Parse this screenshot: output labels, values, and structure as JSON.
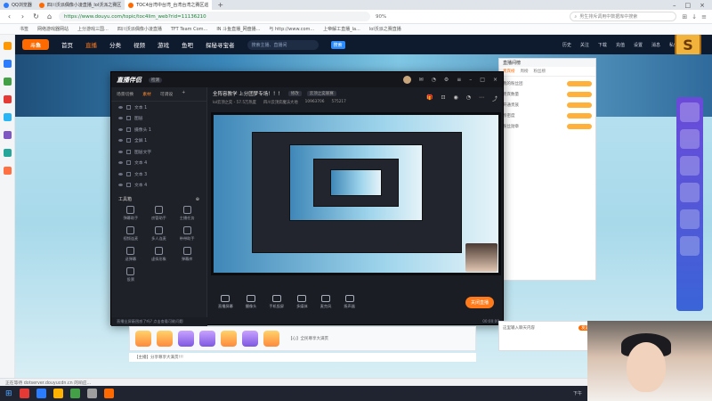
{
  "browser": {
    "tabs": [
      {
        "title": "QQ浏览器",
        "color": "#2b7cff",
        "active": false
      },
      {
        "title": "四川沃派偶像小凌直播_lol沃派之赛区",
        "color": "#ff6a00",
        "active": false
      },
      {
        "title": "TOC4台湾中台湾_台湾台湾之赛区巡",
        "color": "#ff6a00",
        "active": true
      }
    ],
    "new_tab": "+",
    "url": "https://www.douyu.com/topic/toc4lim_web?rid=11136210",
    "zoom": "90%",
    "search_placeholder": "男生排斥调用中数据库中搜索",
    "bookmarks": [
      "书签",
      "网络游戏器网站",
      "上分游戏三国...",
      "四川沃派偶像小凌直播",
      "TFT Team Com...",
      "IN 斗鱼直播_网盘播...",
      "与 http://www.com...",
      "上帝解工直播_la...",
      "lol沃派之赛直播"
    ],
    "status_text": "正在等待 dotserver.douyucdn.cn 的响应..."
  },
  "site": {
    "logo": "斗鱼",
    "nav": [
      "首页",
      "直播",
      "分类",
      "视频",
      "游戏",
      "鱼吧",
      "探秘寻宝者"
    ],
    "search_placeholder": "搜索主播、直播间",
    "search_btn": "搜索",
    "header_icons": [
      "历史",
      "关注",
      "下载",
      "充值",
      "设置",
      "消息",
      "私信"
    ],
    "badge": "S",
    "chat_title": "直播间榜",
    "chat_tabs": [
      "贵宾榜",
      "周榜",
      "粉丝榜"
    ],
    "chat_rows": [
      "我的粉丝团",
      "贵宾数量",
      "开通贵族",
      "亲密度",
      "粉丝勋章"
    ],
    "chat_input_placeholder": "这里输入聊天内容",
    "chat_send": "发送",
    "gift_text": "【心】全民尊享大满贯",
    "follow_text": "【主播】分享尊享大满贯!!!"
  },
  "app": {
    "logo": "直播伴侣",
    "version": "检测",
    "left_tabs": [
      "场景切换",
      "素材",
      "可调设"
    ],
    "left_add": "+",
    "scenes": [
      "文本 1",
      "图层",
      "摄像头 1",
      "全屏 1",
      "图层文字",
      "文本 4",
      "文本 3",
      "文本 4"
    ],
    "tools_title": "工具箱",
    "tools": [
      "弹幕助手",
      "房管助手",
      "主播任务",
      "视频连麦",
      "多人连麦",
      "带带助手",
      "送弹幕",
      "虚拟形象",
      "弹幕库",
      "投票"
    ],
    "left_footer": "直播业屏蔽困惑了吗? 点击查看可能问题",
    "room_title": "全阵容教学 上分团梦专场！！！",
    "room_edit": "修改",
    "room_tag": "云顶之奕联赛",
    "room_meta": [
      "lol云顶之奕 - 57.5万热度",
      "四川云顶弈魔法大地",
      "10963706",
      "575217"
    ],
    "bottom_tools": [
      "直播屏幕",
      "摄像头",
      "手机投屏",
      "多媒体",
      "麦克风",
      "扬声器"
    ],
    "live_button": "关闭直播",
    "status_time": "00:00:00"
  },
  "taskbar": {
    "apps": [
      "#e53935",
      "#2b7cff",
      "#ffb300",
      "#43a047",
      "#9e9e9e",
      "#ff6a00"
    ],
    "sys": "下午"
  }
}
